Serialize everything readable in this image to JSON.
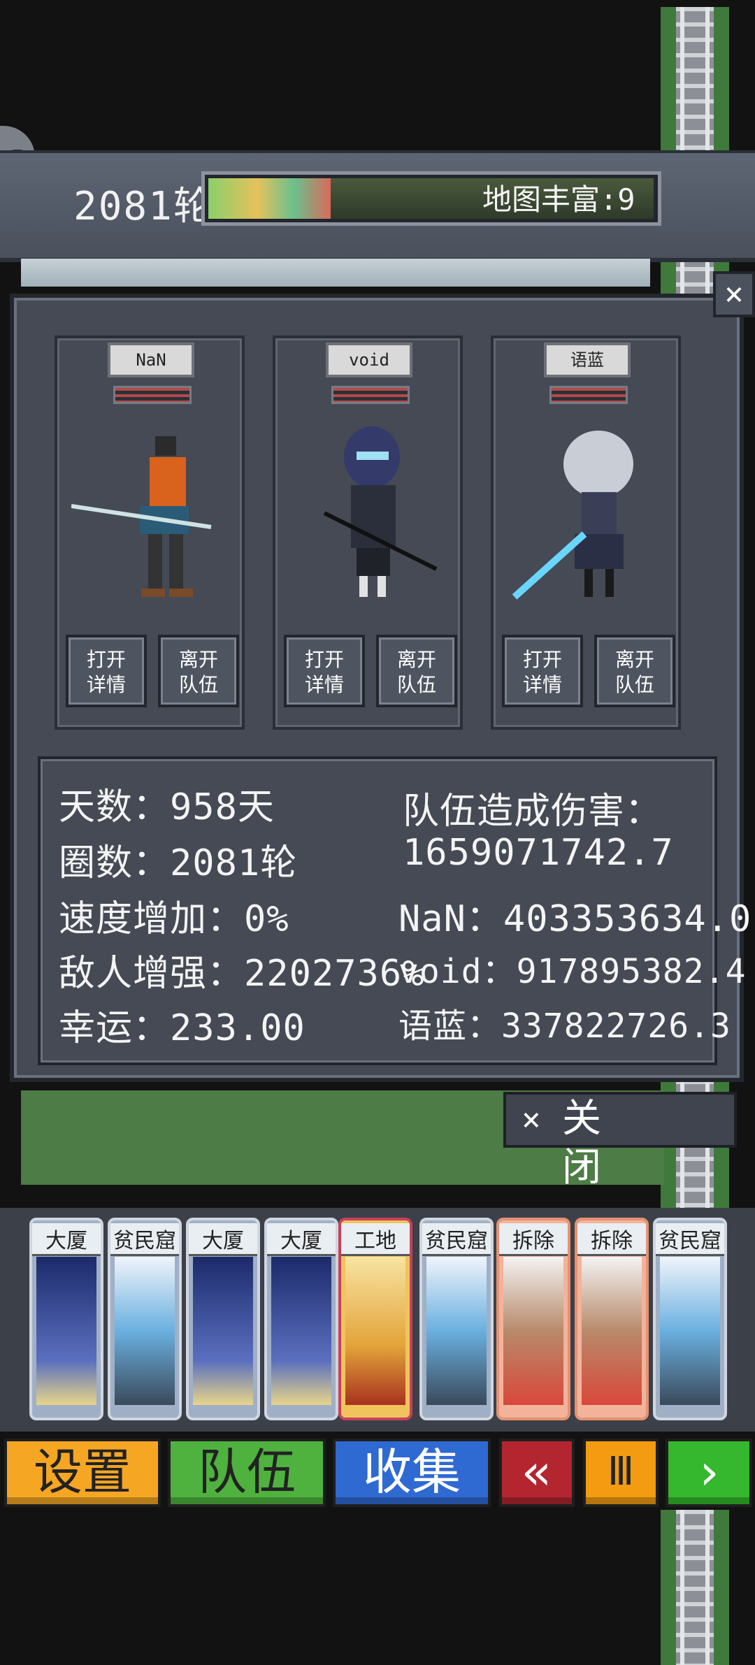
{
  "header": {
    "round": "2081轮",
    "map_wealth": "地图丰富:9"
  },
  "team": [
    {
      "name": "NaN",
      "open_label": [
        "打开",
        "详情"
      ],
      "leave_label": [
        "离开",
        "队伍"
      ]
    },
    {
      "name": "void",
      "open_label": [
        "打开",
        "详情"
      ],
      "leave_label": [
        "离开",
        "队伍"
      ]
    },
    {
      "name": "语蓝",
      "open_label": [
        "打开",
        "详情"
      ],
      "leave_label": [
        "离开",
        "队伍"
      ]
    }
  ],
  "stats": {
    "days": "天数：958天",
    "laps": "圈数：2081轮",
    "speed": "速度增加：0%",
    "enemy": "敌人增强：2202736%",
    "luck": "幸运：233.00",
    "damage_title": "队伍造成伤害：",
    "damage_total": "1659071742.7",
    "dmg_nan": "NaN：403353634.0",
    "dmg_void": "void：917895382.4",
    "dmg_yulan": "语蓝：337822726.3"
  },
  "close_label": "关  闭",
  "close_x": "×",
  "tile_cards": [
    "大厦",
    "贫民窟",
    "大厦",
    "大厦",
    "工地",
    "贫民窟",
    "拆除",
    "拆除",
    "贫民窟"
  ],
  "buttons": {
    "settings": "设置",
    "team": "队伍",
    "collect": "收集",
    "rewind": "«",
    "pause": "Ⅲ",
    "next": "›"
  },
  "colors": {
    "settings": "#f5a623",
    "team": "#4fb23e",
    "collect": "#2f6ad3",
    "rewind": "#b3262f",
    "pause": "#f39c12",
    "next": "#35b82d"
  }
}
